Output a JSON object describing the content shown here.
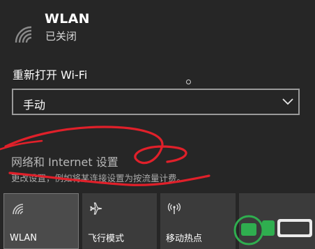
{
  "wlan": {
    "title": "WLAN",
    "status": "已关闭",
    "icon": "wifi-icon"
  },
  "reopen": {
    "label": "重新打开 Wi-Fi",
    "selected": "手动"
  },
  "network_settings": {
    "link": "网络和 Internet 设置",
    "description": "更改设置，例如将某连接设置为按流量计费。"
  },
  "tiles": [
    {
      "label": "WLAN",
      "icon": "wifi-icon",
      "active": true
    },
    {
      "label": "飞行模式",
      "icon": "airplane-icon",
      "active": false
    },
    {
      "label": "移动热点",
      "icon": "hotspot-icon",
      "active": false
    }
  ],
  "colors": {
    "background": "#262626",
    "annotation": "#e0202a"
  }
}
